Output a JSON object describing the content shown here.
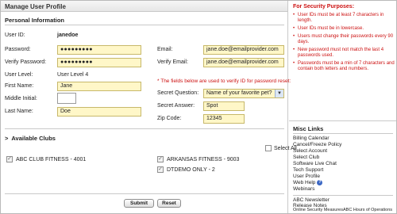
{
  "header": {
    "title": "Manage User Profile"
  },
  "personal": {
    "section_title": "Personal Information",
    "user_id_label": "User ID:",
    "user_id_value": "janedoe",
    "password_label": "Password:",
    "password_value": "●●●●●●●●●",
    "verify_password_label": "Verify Password:",
    "verify_password_value": "●●●●●●●●●",
    "user_level_label": "User Level:",
    "user_level_value": "User Level 4",
    "first_name_label": "First Name:",
    "first_name_value": "Jane",
    "middle_initial_label": "Middle Initial:",
    "middle_initial_value": "",
    "last_name_label": "Last Name:",
    "last_name_value": "Doe",
    "email_label": "Email:",
    "email_value": "jane.doe@emailprovider.com",
    "verify_email_label": "Verify Email:",
    "verify_email_value": "jane.doe@emailprovider.com",
    "verify_note": "* The fields below are used to verify ID for password reset:",
    "secret_question_label": "Secret Question:",
    "secret_question_value": "Name of your favorite pet?",
    "secret_answer_label": "Secret Answer:",
    "secret_answer_value": "Spot",
    "zip_label": "Zip Code:",
    "zip_value": "12345"
  },
  "clubs": {
    "section_title": "Available Clubs",
    "toggle_glyph": ">",
    "select_all_label": "Select All",
    "items": [
      {
        "name": "ABC CLUB FITNESS  - 4001",
        "checked": true
      },
      {
        "name": "ARKANSAS FITNESS - 9003",
        "checked": true
      },
      {
        "name": "DTDEMO ONLY - 2",
        "checked": true
      }
    ]
  },
  "actions": {
    "submit_label": "Submit",
    "reset_label": "Reset"
  },
  "security": {
    "title": "For Security Purposes:",
    "items": [
      "User IDs must be at least 7 characters in length.",
      "User IDs must be in lowercase.",
      "Users must change their passwords every 90 days.",
      "New password must not match the last 4 passwords used.",
      "Passwords must be a min of 7 characters and contain both letters and numbers."
    ]
  },
  "misc": {
    "title": "Misc Links",
    "links": [
      "Billing Calendar",
      "Cancel/Freeze Policy",
      "Select Account",
      "Select Club",
      "Software Live Chat",
      "Tech Support",
      "User Profile",
      "Web Help",
      "Webinars"
    ],
    "help_icon": "?",
    "bottom_links": [
      "ABC Newsletter",
      "Release Notes",
      "Online Security Measures",
      "ABC Hours of Operations"
    ]
  },
  "colors": {
    "required_field_bg": "#fff7c8",
    "security_text": "#cc1111",
    "help_icon_bg": "#3b67c4"
  }
}
